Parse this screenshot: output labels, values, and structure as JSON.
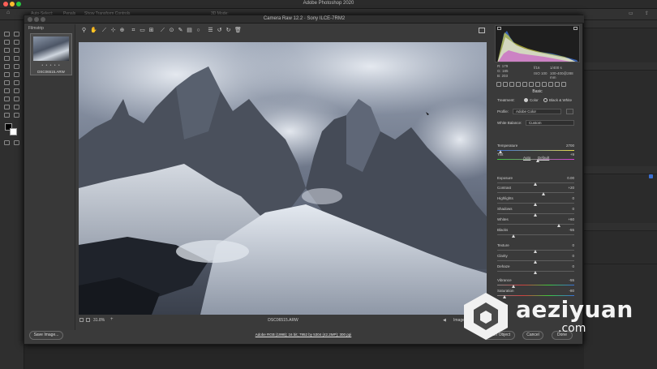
{
  "app": {
    "title": "Adobe Photoshop 2020"
  },
  "options_bar": {
    "auto_select": "Auto-Select:",
    "auto_select_value": "Penals",
    "show_transform": "Show Transform Controls",
    "mode_3d": "3D Mode:"
  },
  "acr": {
    "title": "Camera Raw 12.2  ·  Sony ILCE-7RM2",
    "filmstrip": {
      "header": "Filmstrip",
      "stars": "• • • • •",
      "file_name": "DSC06515.ARW"
    },
    "status": {
      "zoom": "31.8%",
      "file_name": "DSC06515.ARW",
      "image_count": "Image 1/1"
    },
    "histogram": {
      "r": "R:   179",
      "g": "G:   185",
      "b": "B:   203",
      "aperture": "f/16",
      "shutter": "1/400 s",
      "iso": "ISO 100",
      "lens": "100-400@288 mm"
    },
    "panel": {
      "title": "Basic",
      "treatment_label": "Treatment:",
      "treatment_color": "Color",
      "treatment_bw": "Black & White",
      "profile_label": "Profile:",
      "profile_value": "Adobe Color",
      "wb_label": "White Balance:",
      "wb_value": "Custom",
      "auto": "Auto",
      "default": "Default",
      "sliders": [
        {
          "label": "Temperature",
          "value": "2700",
          "pos": 0.05
        },
        {
          "label": "Tint",
          "value": "+9",
          "pos": 0.53
        },
        {
          "label": "Exposure",
          "value": "0.00",
          "pos": 0.5
        },
        {
          "label": "Contrast",
          "value": "+20",
          "pos": 0.6
        },
        {
          "label": "Highlights",
          "value": "0",
          "pos": 0.5
        },
        {
          "label": "Shadows",
          "value": "0",
          "pos": 0.5
        },
        {
          "label": "Whites",
          "value": "+60",
          "pos": 0.8
        },
        {
          "label": "Blacks",
          "value": "-55",
          "pos": 0.22
        },
        {
          "label": "Texture",
          "value": "0",
          "pos": 0.5
        },
        {
          "label": "Clarity",
          "value": "0",
          "pos": 0.5
        },
        {
          "label": "Dehaze",
          "value": "0",
          "pos": 0.5
        },
        {
          "label": "Vibrance",
          "value": "-55",
          "pos": 0.22
        },
        {
          "label": "Saturation",
          "value": "-80",
          "pos": 0.1
        }
      ]
    },
    "buttons": {
      "save": "Save Image...",
      "open": "Open Object",
      "cancel": "Cancel",
      "done": "Done"
    },
    "footer_link": "Adobe RGB (1998); 16 bit; 7952 by 5304 (42.2MP); 300 ppi"
  },
  "watermark": {
    "brand": "aeziyuan",
    "suffix": ".com"
  }
}
